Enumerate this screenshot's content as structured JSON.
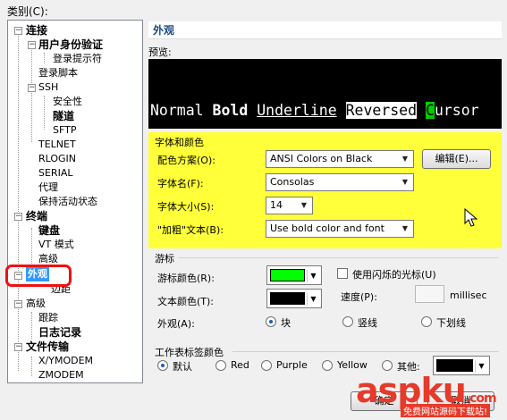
{
  "category_label": "类别(C):",
  "tree": {
    "items": [
      {
        "label": "连接"
      },
      {
        "label": "用户身份验证"
      },
      {
        "label": "登录提示符"
      },
      {
        "label": "登录脚本"
      },
      {
        "label": "SSH"
      },
      {
        "label": "安全性"
      },
      {
        "label": "隧道"
      },
      {
        "label": "SFTP"
      },
      {
        "label": "TELNET"
      },
      {
        "label": "RLOGIN"
      },
      {
        "label": "SERIAL"
      },
      {
        "label": "代理"
      },
      {
        "label": "保持活动状态"
      },
      {
        "label": "终端"
      },
      {
        "label": "键盘"
      },
      {
        "label": "VT 模式"
      },
      {
        "label": "高级"
      },
      {
        "label": "外观"
      },
      {
        "label": "边距"
      },
      {
        "label": "高级"
      },
      {
        "label": "跟踪"
      },
      {
        "label": "日志记录"
      },
      {
        "label": "文件传输"
      },
      {
        "label": "X/YMODEM"
      },
      {
        "label": "ZMODEM"
      }
    ]
  },
  "panel": {
    "title": "外观",
    "preview_label": "预览:"
  },
  "terminal": {
    "line1": [
      "Normal",
      "Bold",
      "Underline",
      "Reversed",
      "C",
      "ursor"
    ],
    "colors": [
      "black",
      "red",
      "green",
      "yellow",
      "blue",
      "magenta",
      "cyan"
    ]
  },
  "font_group": {
    "title": "字体和颜色",
    "scheme_label": "配色方案(O):",
    "scheme_value": "ANSI Colors on Black",
    "edit_button": "编辑(E)...",
    "font_label": "字体名(F):",
    "font_value": "Consolas",
    "size_label": "字体大小(S):",
    "size_value": "14",
    "bold_label": "\"加粗\"文本(B):",
    "bold_value": "Use bold color and font"
  },
  "cursor_group": {
    "title": "游标",
    "cursor_color_label": "游标颜色(R):",
    "text_color_label": "文本颜色(T):",
    "blink_label": "使用闪烁的光标(U)",
    "speed_label": "速度(P):",
    "speed_unit": "millisec",
    "shape_label": "外观(A):",
    "shapes": [
      "块",
      "竖线",
      "下划线"
    ]
  },
  "tab_group": {
    "title": "工作表标签颜色",
    "options": [
      "默认",
      "Red",
      "Purple",
      "Yellow",
      "其他:"
    ]
  },
  "buttons": {
    "ok": "确定",
    "cancel": "取消"
  },
  "colors": {
    "cursor": "#00ff00",
    "text": "#000000",
    "highlight": "#ffff3a",
    "selection": "#3399ff"
  },
  "watermark": {
    "brand": "aspku",
    "brand_suffix": ".com",
    "tagline": "免费网站源码下载站!"
  }
}
